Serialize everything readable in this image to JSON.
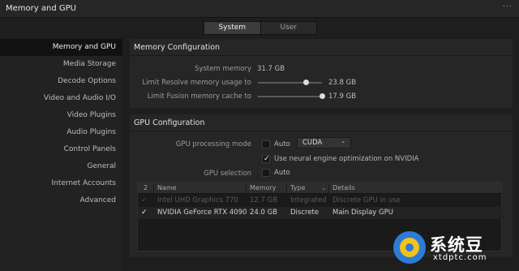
{
  "window": {
    "title": "Memory and GPU",
    "more_icon": "···"
  },
  "tabs": [
    {
      "label": "System",
      "active": true
    },
    {
      "label": "User",
      "active": false
    }
  ],
  "sidebar": {
    "items": [
      {
        "label": "Memory and GPU",
        "active": true
      },
      {
        "label": "Media Storage"
      },
      {
        "label": "Decode Options"
      },
      {
        "label": "Video and Audio I/O"
      },
      {
        "label": "Video Plugins"
      },
      {
        "label": "Audio Plugins"
      },
      {
        "label": "Control Panels"
      },
      {
        "label": "General"
      },
      {
        "label": "Internet Accounts"
      },
      {
        "label": "Advanced"
      }
    ]
  },
  "memory": {
    "header": "Memory Configuration",
    "system_memory_label": "System memory",
    "system_memory_value": "31.7 GB",
    "resolve_label": "Limit Resolve memory usage to",
    "resolve_value": "23.8 GB",
    "resolve_level": 0.75,
    "fusion_label": "Limit Fusion memory cache to",
    "fusion_value": "17.9 GB",
    "fusion_level": 1.0
  },
  "gpu": {
    "header": "GPU Configuration",
    "mode_label": "GPU processing mode",
    "auto_label": "Auto",
    "mode_auto_checked": false,
    "mode_value": "CUDA",
    "neural_label": "Use neural engine optimization on NVIDIA",
    "neural_checked": true,
    "selection_label": "GPU selection",
    "selection_auto_label": "Auto",
    "selection_auto_checked": false,
    "table": {
      "columns": [
        "2",
        "Name",
        "Memory",
        "Type",
        "Details"
      ],
      "rows": [
        {
          "checked": true,
          "enabled": false,
          "name": "Intel UHD Graphics 770",
          "memory": "12.7 GB",
          "type": "Integrated",
          "details": "Discrete GPU in use"
        },
        {
          "checked": true,
          "enabled": true,
          "name": "NVIDIA GeForce RTX 4090",
          "memory": "24.0 GB",
          "type": "Discrete",
          "details": "Main Display GPU"
        }
      ]
    }
  },
  "icons": {
    "check": "✓",
    "chevron_down": "⌄"
  },
  "watermark": {
    "text": "系统豆",
    "url": "xtdptc.com"
  },
  "colors": {
    "background": "#1e1e1e",
    "panel": "#262626",
    "sidebar": "#222222",
    "accent_logo_blue": "#2e7bd6",
    "accent_logo_yellow": "#f4c21b"
  }
}
